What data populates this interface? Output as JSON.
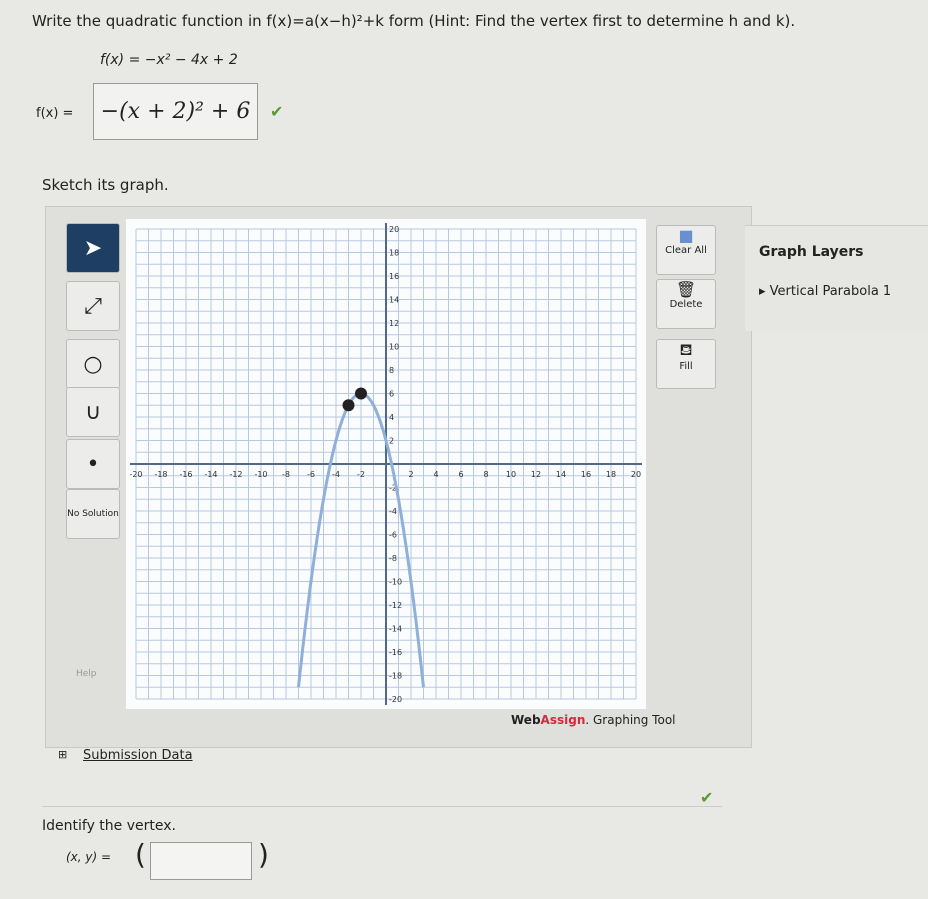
{
  "question": {
    "prompt": "Write the quadratic function in f(x)=a(x−h)²+k form (Hint: Find the vertex first to determine h and k).",
    "given": "f(x) = −x² − 4x + 2",
    "answer_label": "f(x) =",
    "answer": "−(x + 2)² + 6",
    "status": "correct"
  },
  "sketch_label": "Sketch its graph.",
  "tools": {
    "select": "select-icon",
    "line": "line-icon",
    "circle": "circle-icon",
    "parabola": "parabola-icon",
    "point": "point-icon",
    "no_solution": "No Solution",
    "help": "Help"
  },
  "right_tools": {
    "clear_all": "Clear All",
    "delete": "Delete",
    "fill": "Fill"
  },
  "brand": {
    "web": "Web",
    "assign": "Assign",
    "suffix": ". Graphing Tool",
    "accent": "#d9283a"
  },
  "layers": {
    "title": "Graph Layers",
    "item": "Vertical Parabola 1"
  },
  "chart_data": {
    "type": "line",
    "xlim": [
      -20,
      20
    ],
    "ylim": [
      -20,
      20
    ],
    "grid": true,
    "xticks": [
      -20,
      -18,
      -16,
      -14,
      -12,
      -10,
      -8,
      -6,
      -4,
      -2,
      2,
      4,
      6,
      8,
      10,
      12,
      14,
      16,
      18,
      20
    ],
    "yticks": [
      -20,
      -18,
      -16,
      -14,
      -12,
      -10,
      -8,
      -6,
      -4,
      -2,
      2,
      4,
      6,
      8,
      10,
      12,
      14,
      16,
      18,
      20
    ],
    "curve": {
      "function": "-(x+2)^2+6",
      "color": "#8fb0d8"
    },
    "points": [
      {
        "x": -3,
        "y": 5
      },
      {
        "x": -2,
        "y": 6
      }
    ]
  },
  "submission": "Submission Data",
  "vertex": {
    "prompt": "Identify the vertex.",
    "label": "(x, y) =",
    "open": "(",
    "close": ")",
    "value": ""
  }
}
